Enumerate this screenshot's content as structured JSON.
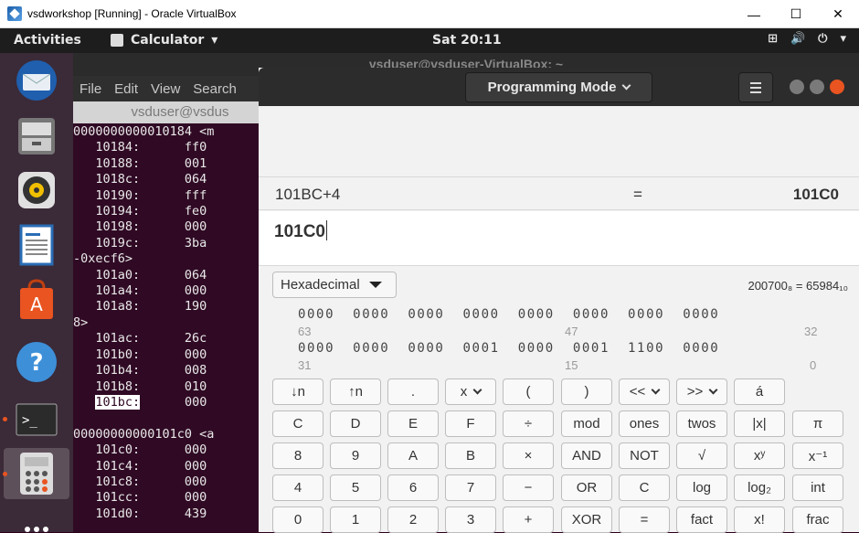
{
  "host_window": {
    "title": "vsdworkshop [Running] - Oracle VirtualBox"
  },
  "topbar": {
    "activities": "Activities",
    "app_menu": "Calculator",
    "clock": "Sat 20:11"
  },
  "terminal": {
    "title": "vsduser@vsduser-VirtualBox: ~",
    "menu": [
      "File",
      "Edit",
      "View",
      "Search"
    ],
    "tab_title": "vsduser@vsdus",
    "lines": [
      "0000000000010184 <m",
      "   10184:      ff0",
      "   10188:      001",
      "   1018c:      064",
      "   10190:      fff",
      "   10194:      fe0",
      "   10198:      000",
      "   1019c:      3ba",
      "-0xecf6>",
      "   101a0:      064",
      "   101a4:      000",
      "   101a8:      190",
      "8>",
      "   101ac:      26c",
      "   101b0:      000",
      "   101b4:      008",
      "   101b8:      010",
      "   101bc:      000",
      "",
      "00000000000101c0 <a",
      "   101c0:      000",
      "   101c4:      000",
      "   101c8:      000",
      "   101cc:      000",
      "   101d0:      439"
    ]
  },
  "calculator": {
    "mode": "Programming Mode",
    "history": {
      "expression": "101BC+4",
      "equals": "=",
      "result": "101C0"
    },
    "entry": "101C0",
    "base": "Hexadecimal",
    "conversion": "200700₈ = 65984₁₀",
    "bits_row1": "0000  0000  0000  0000  0000  0000  0000  0000",
    "bits_row2": "0000  0000  0000  0001  0000  0001  1100  0000",
    "bit_labels": [
      "63",
      "47",
      "32",
      "31",
      "15",
      "0"
    ],
    "keys": [
      [
        "↓n",
        "↑n",
        ".",
        "x",
        "(",
        ")",
        "<<",
        ">>",
        "á"
      ],
      [
        "C",
        "D",
        "E",
        "F",
        "÷",
        "mod",
        "ones",
        "twos",
        "|x|",
        "π"
      ],
      [
        "8",
        "9",
        "A",
        "B",
        "×",
        "AND",
        "NOT",
        "√",
        "xʸ",
        "x⁻¹"
      ],
      [
        "4",
        "5",
        "6",
        "7",
        "−",
        "OR",
        "C",
        "log",
        "log₂",
        "int"
      ],
      [
        "0",
        "1",
        "2",
        "3",
        "+",
        "XOR",
        "=",
        "fact",
        "x!",
        "frac"
      ]
    ]
  }
}
